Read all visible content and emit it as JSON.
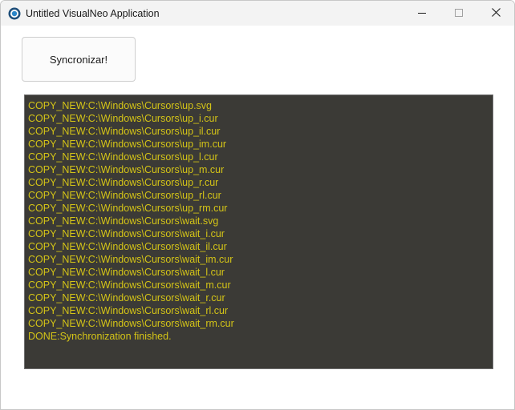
{
  "window": {
    "title": "Untitled VisualNeo Application",
    "controls": {
      "minimize_icon": "minimize-icon",
      "maximize_icon": "maximize-icon",
      "close_icon": "close-icon"
    }
  },
  "toolbar": {
    "sync_label": "Syncronizar!"
  },
  "log": {
    "text_color": "#d4c417",
    "background_color": "#3b3a36",
    "lines": [
      "COPY_NEW:C:\\Windows\\Cursors\\up.svg",
      "COPY_NEW:C:\\Windows\\Cursors\\up_i.cur",
      "COPY_NEW:C:\\Windows\\Cursors\\up_il.cur",
      "COPY_NEW:C:\\Windows\\Cursors\\up_im.cur",
      "COPY_NEW:C:\\Windows\\Cursors\\up_l.cur",
      "COPY_NEW:C:\\Windows\\Cursors\\up_m.cur",
      "COPY_NEW:C:\\Windows\\Cursors\\up_r.cur",
      "COPY_NEW:C:\\Windows\\Cursors\\up_rl.cur",
      "COPY_NEW:C:\\Windows\\Cursors\\up_rm.cur",
      "COPY_NEW:C:\\Windows\\Cursors\\wait.svg",
      "COPY_NEW:C:\\Windows\\Cursors\\wait_i.cur",
      "COPY_NEW:C:\\Windows\\Cursors\\wait_il.cur",
      "COPY_NEW:C:\\Windows\\Cursors\\wait_im.cur",
      "COPY_NEW:C:\\Windows\\Cursors\\wait_l.cur",
      "COPY_NEW:C:\\Windows\\Cursors\\wait_m.cur",
      "COPY_NEW:C:\\Windows\\Cursors\\wait_r.cur",
      "COPY_NEW:C:\\Windows\\Cursors\\wait_rl.cur",
      "COPY_NEW:C:\\Windows\\Cursors\\wait_rm.cur",
      "DONE:Synchronization finished."
    ]
  }
}
